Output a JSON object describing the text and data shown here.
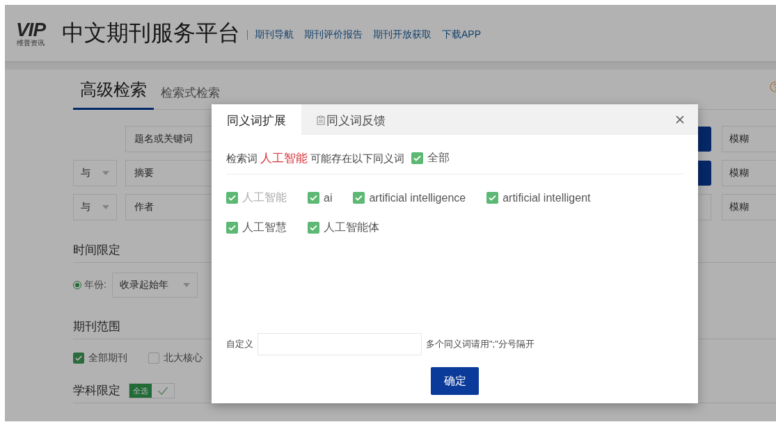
{
  "header": {
    "logo": {
      "mark": "VIP",
      "caption": "维普资讯"
    },
    "title": "中文期刊服务平台",
    "nav": [
      "期刊导航",
      "期刊评价报告",
      "期刊开放获取",
      "下载APP"
    ]
  },
  "search_tabs": [
    {
      "label": "高级检索",
      "selected": true
    },
    {
      "label": "检索式检索",
      "selected": false
    }
  ],
  "search_rows": [
    {
      "logic": null,
      "field": "题名或关键词",
      "kind": "button",
      "match": "模糊"
    },
    {
      "logic": "与",
      "field": "摘要",
      "kind": "button",
      "match": "模糊"
    },
    {
      "logic": "与",
      "field": "作者",
      "kind": "field",
      "match": "模糊"
    }
  ],
  "time_limit": {
    "title": "时间限定",
    "option": {
      "label": "年份:",
      "selected": true
    },
    "start": "收录起始年"
  },
  "journal_scope": {
    "title": "期刊范围",
    "options": [
      {
        "label": "全部期刊",
        "checked": true
      },
      {
        "label": "北大核心",
        "checked": false
      }
    ]
  },
  "subject_limit": {
    "title": "学科限定",
    "select_all": "全选"
  },
  "dialog": {
    "tabs": [
      {
        "label": "同义词扩展",
        "selected": true,
        "kind": "plain"
      },
      {
        "label": "同义词反馈",
        "selected": false,
        "kind": "icon"
      }
    ],
    "intro": {
      "prefix": "检索词",
      "term": "人工智能",
      "suffix": "可能存在以下同义词"
    },
    "all": {
      "label": "全部",
      "checked": true
    },
    "synonyms": [
      {
        "label": "人工智能",
        "checked": true,
        "disabled": true
      },
      {
        "label": "ai",
        "checked": true,
        "disabled": false
      },
      {
        "label": "artificial intelligence",
        "checked": true,
        "disabled": false
      },
      {
        "label": "artificial intelligent",
        "checked": true,
        "disabled": false
      },
      {
        "label": "人工智慧",
        "checked": true,
        "disabled": false
      },
      {
        "label": "人工智能体",
        "checked": true,
        "disabled": false
      }
    ],
    "custom": {
      "label": "自定义",
      "hint": "多个同义词请用\";\"分号隔开"
    },
    "confirm": "确定"
  }
}
